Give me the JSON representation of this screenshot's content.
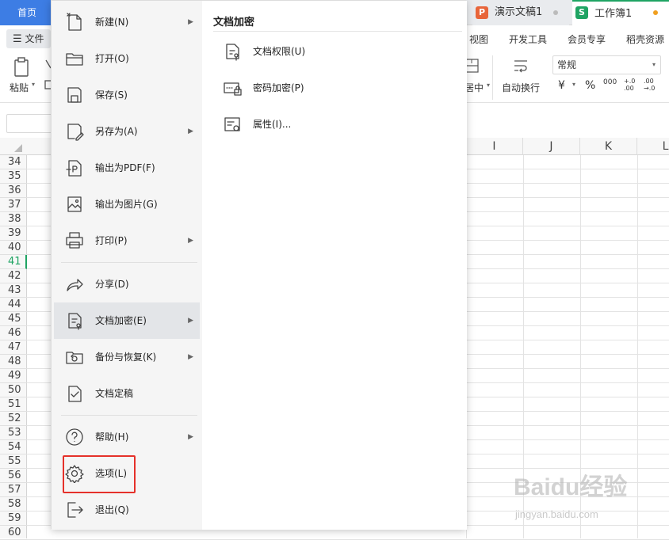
{
  "tabs": {
    "home": "首页",
    "ppt": {
      "label": "演示文稿1",
      "badge": "P",
      "color": "#e8653a"
    },
    "xls": {
      "label": "工作簿1",
      "badge": "S",
      "color": "#1fa463"
    }
  },
  "menubar": {
    "file": "文件",
    "items": [
      "视图",
      "开发工具",
      "会员专享",
      "稻壳资源"
    ]
  },
  "ribbon": {
    "paste": "粘贴",
    "center": "居中",
    "wrap": "自动换行",
    "format_select": "常规",
    "currency": "¥",
    "percent": "%",
    "thousands": "000",
    "inc_decimal": "+.0 .00",
    "dec_decimal": ".00 →.0"
  },
  "sheet": {
    "columns": [
      "I",
      "J",
      "K",
      "L"
    ],
    "rows": [
      "34",
      "35",
      "36",
      "37",
      "38",
      "39",
      "40",
      "41",
      "42",
      "43",
      "44",
      "45",
      "46",
      "47",
      "48",
      "49",
      "50",
      "51",
      "52",
      "53",
      "54",
      "55",
      "56",
      "57",
      "58",
      "59",
      "60"
    ],
    "selected_row": "41"
  },
  "file_menu": {
    "items": [
      {
        "label": "新建(N)",
        "icon": "new-file-icon",
        "submenu": true
      },
      {
        "label": "打开(O)",
        "icon": "folder-open-icon",
        "submenu": false
      },
      {
        "label": "保存(S)",
        "icon": "save-icon",
        "submenu": false
      },
      {
        "label": "另存为(A)",
        "icon": "save-as-icon",
        "submenu": true
      },
      {
        "label": "输出为PDF(F)",
        "icon": "pdf-export-icon",
        "submenu": false
      },
      {
        "label": "输出为图片(G)",
        "icon": "image-export-icon",
        "submenu": false
      },
      {
        "label": "打印(P)",
        "icon": "printer-icon",
        "submenu": true
      },
      {
        "label": "分享(D)",
        "icon": "share-icon",
        "submenu": false
      },
      {
        "label": "文档加密(E)",
        "icon": "document-lock-icon",
        "submenu": true,
        "active": true
      },
      {
        "label": "备份与恢复(K)",
        "icon": "backup-restore-icon",
        "submenu": true
      },
      {
        "label": "文档定稿",
        "icon": "document-final-icon",
        "submenu": false
      },
      {
        "label": "帮助(H)",
        "icon": "help-icon",
        "submenu": true
      },
      {
        "label": "选项(L)",
        "icon": "gear-icon",
        "submenu": false,
        "highlighted": true
      },
      {
        "label": "退出(Q)",
        "icon": "exit-icon",
        "submenu": false
      }
    ],
    "submenu": {
      "title": "文档加密",
      "items": [
        {
          "label": "文档权限(U)",
          "icon": "document-permission-icon"
        },
        {
          "label": "密码加密(P)",
          "icon": "password-lock-icon"
        },
        {
          "label": "属性(I)...",
          "icon": "properties-icon"
        }
      ]
    },
    "highlight_color": "#e5312a"
  },
  "watermark": {
    "brand": "Baidu经验",
    "url": "jingyan.baidu.com"
  }
}
